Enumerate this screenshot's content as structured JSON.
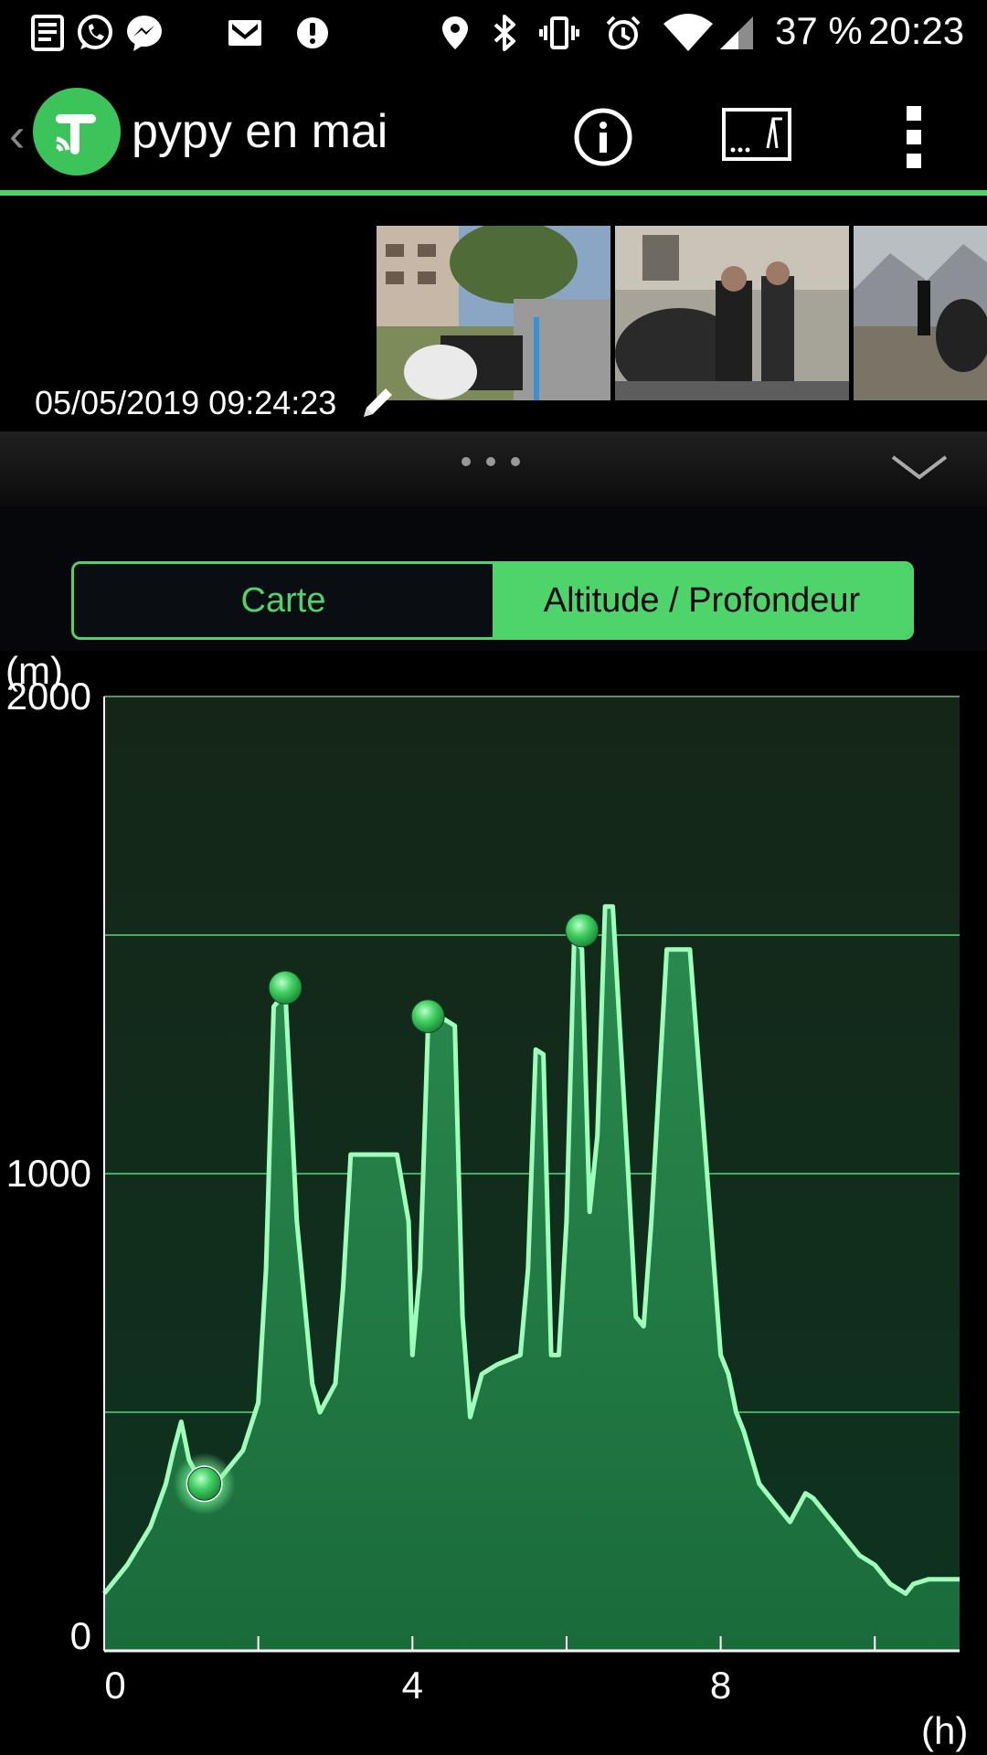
{
  "status_bar": {
    "battery": "37 %",
    "time": "20:23",
    "left_icons": [
      "news-icon",
      "whatsapp-icon",
      "messenger-icon",
      "gmail-icon",
      "notification-dot-icon"
    ],
    "right_icons": [
      "location-icon",
      "bluetooth-icon",
      "vibrate-icon",
      "alarm-icon",
      "wifi-icon",
      "signal-icon"
    ]
  },
  "app_bar": {
    "title": "pypy en mai",
    "accent_color": "#4fd36b",
    "actions": [
      "info-icon",
      "chart-view-icon",
      "overflow-menu-icon"
    ]
  },
  "photos": {
    "date": "05/05/2019 09:24:23",
    "count_visible": 3
  },
  "drawer": {
    "handle": "more-dots-icon",
    "expand": "chevron-down-icon"
  },
  "tabs": {
    "items": [
      {
        "label": "Carte",
        "selected": false
      },
      {
        "label": "Altitude / Profondeur",
        "selected": true
      }
    ]
  },
  "chart_data": {
    "type": "area",
    "ylabel": "(m)",
    "xlabel": "(h)",
    "ylim": [
      0,
      2000
    ],
    "xlim": [
      0,
      11.1
    ],
    "yticks": [
      "2000",
      "1000",
      "0"
    ],
    "xticks": [
      "0",
      "4",
      "8"
    ],
    "grid": true,
    "series": [
      {
        "x": [
          0,
          0.3,
          0.6,
          0.8,
          0.9,
          1.0,
          1.1,
          1.3,
          1.5,
          1.8,
          2.0,
          2.1,
          2.2,
          2.35,
          2.5,
          2.7,
          2.8,
          3.0,
          3.1,
          3.2,
          3.5,
          3.8,
          3.95,
          4.0,
          4.1,
          4.2,
          4.35,
          4.55,
          4.65,
          4.75,
          4.9,
          5.1,
          5.4,
          5.5,
          5.6,
          5.7,
          5.8,
          5.9,
          6.0,
          6.1,
          6.2,
          6.3,
          6.4,
          6.5,
          6.6,
          6.8,
          6.9,
          7.0,
          7.1,
          7.3,
          7.4,
          7.6,
          7.8,
          8.0,
          8.1,
          8.2,
          8.3,
          8.5,
          8.7,
          8.9,
          9.1,
          9.2,
          9.4,
          9.6,
          9.8,
          10.0,
          10.2,
          10.4,
          10.5,
          10.7,
          10.9,
          11.1
        ],
        "y": [
          120,
          180,
          260,
          350,
          420,
          480,
          400,
          340,
          360,
          420,
          520,
          800,
          1350,
          1380,
          900,
          560,
          500,
          560,
          760,
          1040,
          1040,
          1040,
          900,
          620,
          800,
          1300,
          1330,
          1310,
          700,
          490,
          580,
          600,
          620,
          800,
          1260,
          1250,
          620,
          620,
          900,
          1500,
          1470,
          920,
          1080,
          1560,
          1560,
          1000,
          700,
          680,
          900,
          1470,
          1470,
          1470,
          1050,
          620,
          580,
          500,
          460,
          350,
          310,
          270,
          330,
          320,
          280,
          240,
          200,
          180,
          140,
          120,
          140,
          150,
          150,
          150
        ]
      }
    ],
    "markers": [
      {
        "x": 1.3,
        "y": 350
      },
      {
        "x": 2.35,
        "y": 1390
      },
      {
        "x": 4.2,
        "y": 1330
      },
      {
        "x": 6.2,
        "y": 1510
      }
    ]
  }
}
